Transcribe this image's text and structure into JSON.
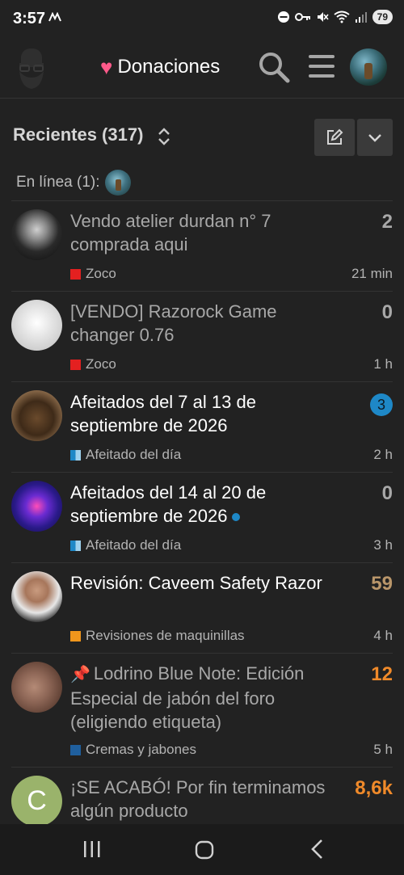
{
  "status": {
    "time": "3:57",
    "battery": "79"
  },
  "header": {
    "donate_label": "Donaciones",
    "heart": "♥"
  },
  "list": {
    "title": "Recientes (317)",
    "online_label": "En línea (1):"
  },
  "topics": [
    {
      "title": "Vendo atelier durdan n° 7 comprada aqui",
      "count": "2",
      "count_color": "#a8a8a8",
      "category": "Zoco",
      "category_color": "#e42020",
      "time": "21 min",
      "state": "read",
      "avatar": "av-skull"
    },
    {
      "title": "[VENDO] Razorock Game changer 0.76",
      "count": "0",
      "count_color": "#a8a8a8",
      "category": "Zoco",
      "category_color": "#e42020",
      "time": "1 h",
      "state": "read",
      "avatar": "av-sketch"
    },
    {
      "title": "Afeitados del 7 al 13 de septiembre de 2026",
      "badge": "3",
      "category": "Afeitado del día",
      "category_color": "#1e88c7",
      "time": "2 h",
      "state": "unread",
      "avatar": "av-dog"
    },
    {
      "title": "Afeitados del 14 al 20 de septiembre de 2026",
      "count": "0",
      "count_color": "#a8a8a8",
      "category": "Afeitado del día",
      "category_color": "#1e88c7",
      "time": "3 h",
      "state": "unread",
      "newdot": true,
      "avatar": "av-mandala"
    },
    {
      "title": "Revisión: Caveem Safety Razor",
      "count": "59",
      "count_color": "#b9966a",
      "category": "Revisiones de maquinillas",
      "category_color": "#f0961c",
      "time": "4 h",
      "state": "unread",
      "avatar": "av-man"
    },
    {
      "title": "Lodrino Blue Note: Edición Especial de jabón del foro (eligiendo etiqueta)",
      "count": "12",
      "count_color": "#f08a2a",
      "category": "Cremas y jabones",
      "category_color": "#1f5f9e",
      "time": "5 h",
      "state": "read",
      "pinned": true,
      "avatar": "av-ear"
    },
    {
      "title": "¡SE ACABÓ! Por fin terminamos algún producto",
      "count": "8,6k",
      "count_color": "#f08a2a",
      "state": "read",
      "avatar": "av-c",
      "avatar_letter": "C"
    }
  ]
}
